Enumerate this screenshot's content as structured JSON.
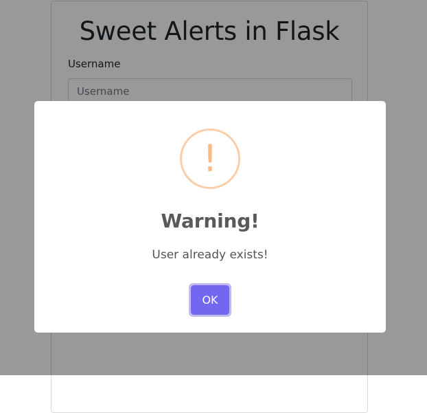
{
  "page": {
    "title": "Sweet Alerts in Flask",
    "form": {
      "username_label": "Username",
      "username_placeholder": "Username",
      "username_value": ""
    }
  },
  "alert": {
    "icon": "warning-icon",
    "icon_glyph": "!",
    "title": "Warning!",
    "message": "User already exists!",
    "confirm_label": "OK",
    "colors": {
      "icon_border": "#facea8",
      "icon_glyph": "#f8bb86",
      "button": "#7367f0"
    }
  }
}
